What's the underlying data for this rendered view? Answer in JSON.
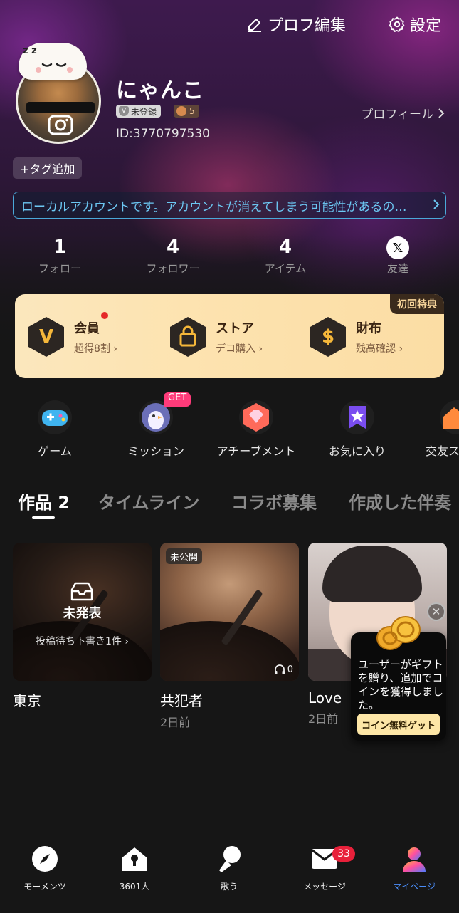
{
  "header": {
    "edit_profile_label": "プロフ編集",
    "settings_label": "設定"
  },
  "profile": {
    "username": "にゃんこ",
    "badge_unregistered": "未登録",
    "badge_level": "5",
    "user_id": "ID:3770797530",
    "profile_link": "プロフィール",
    "add_tag": "+タグ追加",
    "avatar_zzz": "z z",
    "notice": "ローカルアカウントです。アカウントが消えてしまう可能性があるの…"
  },
  "stats": [
    {
      "value": "1",
      "label": "フォロー"
    },
    {
      "value": "4",
      "label": "フォロワー"
    },
    {
      "value": "4",
      "label": "アイテム"
    },
    {
      "value": "𝕏",
      "label": "友達"
    }
  ],
  "benefits": {
    "ribbon": "初回特典",
    "items": [
      {
        "icon": "V",
        "title": "会員",
        "subtitle": "超得8割"
      },
      {
        "icon": "lock",
        "title": "ストア",
        "subtitle": "デコ購入"
      },
      {
        "icon": "$",
        "title": "財布",
        "subtitle": "残高確認"
      }
    ]
  },
  "features": {
    "get_badge": "GET",
    "items": [
      {
        "label": "ゲーム"
      },
      {
        "label": "ミッション"
      },
      {
        "label": "アチーブメント"
      },
      {
        "label": "お気に入り"
      },
      {
        "label": "交友ス"
      }
    ]
  },
  "tabs": [
    {
      "label": "作品 2"
    },
    {
      "label": "タイムライン"
    },
    {
      "label": "コラボ募集"
    },
    {
      "label": "作成した伴奏"
    }
  ],
  "works": [
    {
      "title": "東京",
      "date": "",
      "overlay_title": "未発表",
      "overlay_sub": "投稿待ち下書き1件"
    },
    {
      "title": "共犯者",
      "date": "2日前",
      "tag": "未公開",
      "plays": "0"
    },
    {
      "title": "Love",
      "date": "2日前"
    }
  ],
  "popup": {
    "close": "✕",
    "message": "ユーザーがギフトを贈り、追加でコインを獲得しました。",
    "cta": "コイン無料ゲット"
  },
  "nav": {
    "items": [
      {
        "label": "モーメンツ"
      },
      {
        "label": "3601人"
      },
      {
        "label": "歌う"
      },
      {
        "label": "メッセージ"
      },
      {
        "label": "マイページ"
      }
    ],
    "message_badge": "33"
  },
  "colors": {
    "accent": "#4a8cf7",
    "notice": "#6cc7f2",
    "badge_red": "#e8203a",
    "get_pink": "#ff3b7a"
  }
}
